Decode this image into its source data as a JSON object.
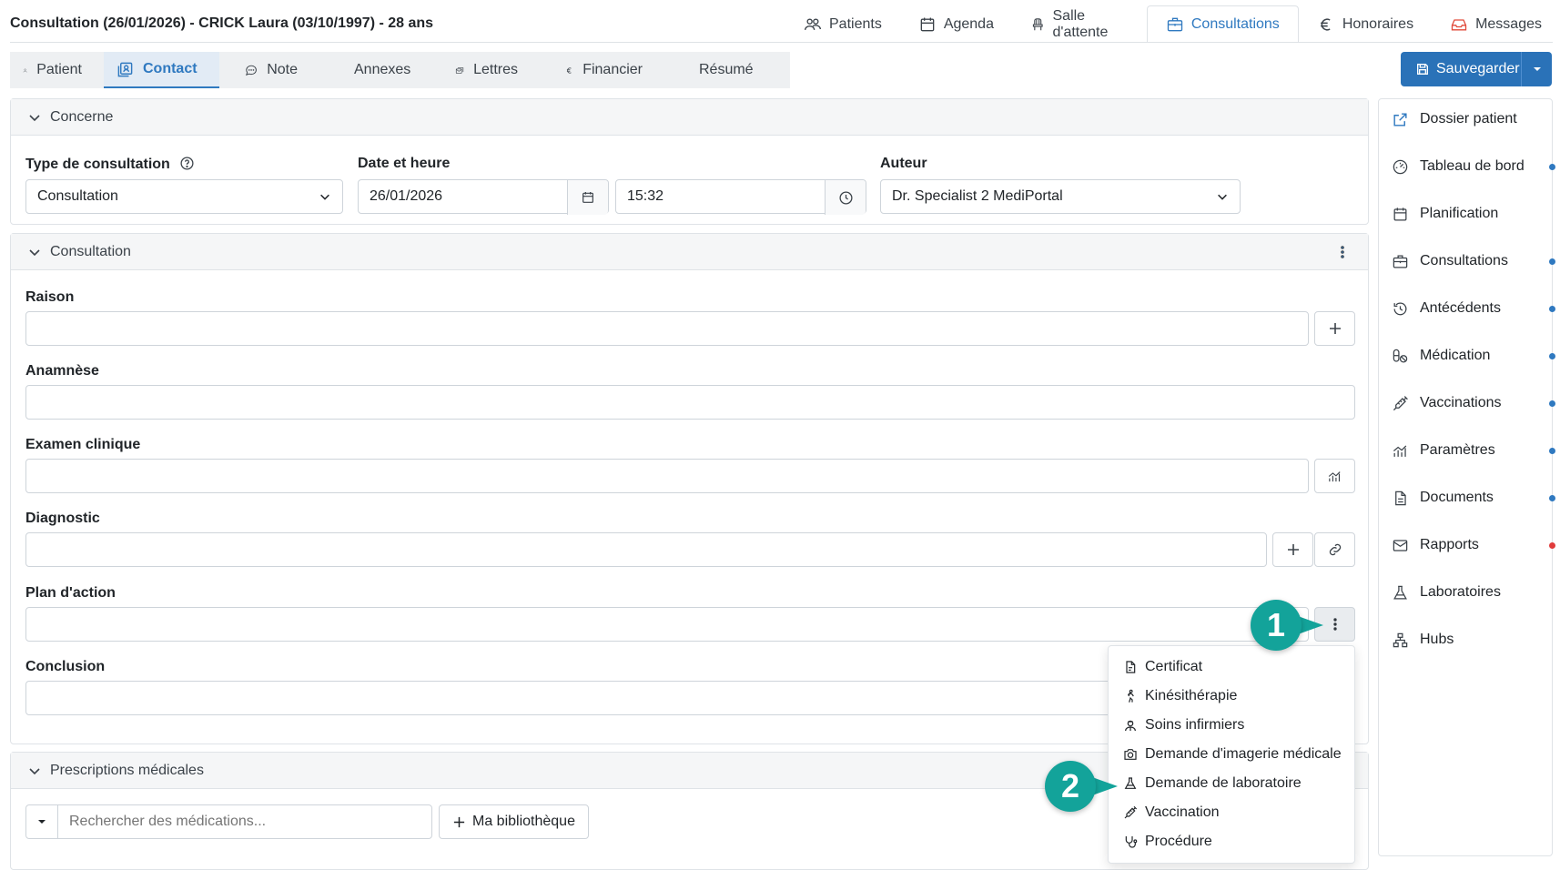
{
  "header": {
    "title": "Consultation (26/01/2026) - CRICK Laura (03/10/1997) - 28 ans",
    "nav": [
      {
        "label": "Patients",
        "icon": "users-icon"
      },
      {
        "label": "Agenda",
        "icon": "calendar-icon"
      },
      {
        "label": "Salle d'attente",
        "icon": "chair-icon"
      },
      {
        "label": "Consultations",
        "icon": "briefcase-icon",
        "active": true
      },
      {
        "label": "Honoraires",
        "icon": "euro-icon"
      },
      {
        "label": "Messages",
        "icon": "inbox-icon"
      }
    ]
  },
  "tabs": [
    {
      "label": "Patient",
      "icon": "person-icon"
    },
    {
      "label": "Contact",
      "icon": "contact-icon",
      "active": true
    },
    {
      "label": "Note",
      "icon": "chat-icon"
    },
    {
      "label": "Annexes",
      "icon": "paperclip-icon"
    },
    {
      "label": "Lettres",
      "icon": "letters-icon"
    },
    {
      "label": "Financier",
      "icon": "euro-icon"
    },
    {
      "label": "Résumé",
      "icon": "check-icon"
    }
  ],
  "save": {
    "label": "Sauvegarder"
  },
  "concerne": {
    "title": "Concerne",
    "type_label": "Type de consultation",
    "type_value": "Consultation",
    "date_label": "Date et heure",
    "date_value": "26/01/2026",
    "time_value": "15:32",
    "author_label": "Auteur",
    "author_value": "Dr. Specialist 2 MediPortal"
  },
  "consultation": {
    "title": "Consultation",
    "raison": "Raison",
    "anamnese": "Anamnèse",
    "examen": "Examen clinique",
    "diagnostic": "Diagnostic",
    "plan": "Plan d'action",
    "conclusion": "Conclusion"
  },
  "prescriptions": {
    "title": "Prescriptions médicales",
    "search_placeholder": "Rechercher des médications...",
    "library_label": "Ma bibliothèque"
  },
  "sidebar": {
    "items": [
      {
        "label": "Dossier patient",
        "icon": "external-link-icon",
        "dot": null
      },
      {
        "label": "Tableau de bord",
        "icon": "dashboard-icon",
        "dot": "#2f79c0"
      },
      {
        "label": "Planification",
        "icon": "calendar-icon",
        "dot": null
      },
      {
        "label": "Consultations",
        "icon": "briefcase-icon",
        "dot": "#2f79c0"
      },
      {
        "label": "Antécédents",
        "icon": "history-icon",
        "dot": "#2f79c0"
      },
      {
        "label": "Médication",
        "icon": "pills-icon",
        "dot": "#2f79c0"
      },
      {
        "label": "Vaccinations",
        "icon": "syringe-icon",
        "dot": "#2f79c0"
      },
      {
        "label": "Paramètres",
        "icon": "chart-icon",
        "dot": "#2f79c0"
      },
      {
        "label": "Documents",
        "icon": "document-icon",
        "dot": "#2f79c0"
      },
      {
        "label": "Rapports",
        "icon": "envelope-icon",
        "dot": "#e03c3c"
      },
      {
        "label": "Laboratoires",
        "icon": "flask-icon",
        "dot": null
      },
      {
        "label": "Hubs",
        "icon": "hubs-icon",
        "dot": null
      }
    ]
  },
  "menu": {
    "items": [
      {
        "label": "Certificat",
        "icon": "certificate-icon"
      },
      {
        "label": "Kinésithérapie",
        "icon": "walking-icon"
      },
      {
        "label": "Soins infirmiers",
        "icon": "nurse-icon"
      },
      {
        "label": "Demande d'imagerie médicale",
        "icon": "camera-icon"
      },
      {
        "label": "Demande de laboratoire",
        "icon": "flask-icon"
      },
      {
        "label": "Vaccination",
        "icon": "syringe-icon"
      },
      {
        "label": "Procédure",
        "icon": "stethoscope-icon"
      }
    ]
  },
  "callouts": [
    "1",
    "2"
  ],
  "colors": {
    "accent": "#2f79c0",
    "primary_button": "#2a72b8",
    "callout": "#13a39a",
    "alert_dot": "#e03c3c"
  }
}
